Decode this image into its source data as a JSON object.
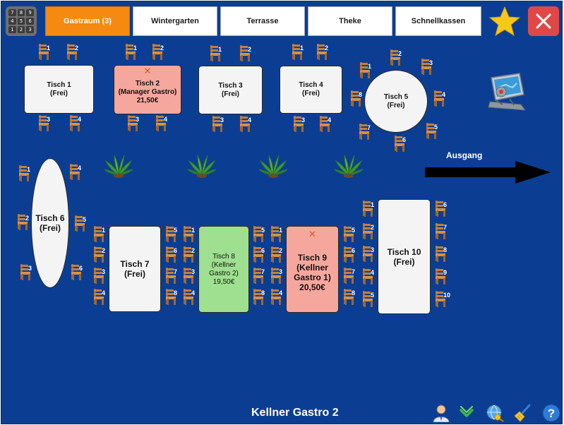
{
  "keypad": {
    "keys": [
      "7",
      "8",
      "9",
      "4",
      "5",
      "6",
      "1",
      "2",
      "3"
    ]
  },
  "tabs": [
    {
      "label": "Gastraum (3)",
      "active": true
    },
    {
      "label": "Wintergarten",
      "active": false
    },
    {
      "label": "Terrasse",
      "active": false
    },
    {
      "label": "Theke",
      "active": false
    },
    {
      "label": "Schnellkassen",
      "active": false
    }
  ],
  "tables": {
    "t1": {
      "name": "Tisch 1",
      "status": "(Frei)"
    },
    "t2": {
      "name": "Tisch 2",
      "status": "(Manager Gastro)",
      "amount": "21,50€"
    },
    "t3": {
      "name": "Tisch 3",
      "status": "(Frei)"
    },
    "t4": {
      "name": "Tisch 4",
      "status": "(Frei)"
    },
    "t5": {
      "name": "Tisch 5",
      "status": "(Frei)"
    },
    "t6": {
      "name": "Tisch 6",
      "status": "(Frei)"
    },
    "t7": {
      "name": "Tisch 7",
      "status": "(Frei)"
    },
    "t8": {
      "name": "Tisch 8",
      "status_line1": "(Kellner",
      "status_line2": "Gastro 2)",
      "amount": "19,50€"
    },
    "t9": {
      "name": "Tisch 9",
      "status_line1": "(Kellner",
      "status_line2": "Gastro 1)",
      "amount": "20,50€"
    },
    "t10": {
      "name": "Tisch 10",
      "status": "(Frei)"
    }
  },
  "exit": {
    "label": "Ausgang"
  },
  "footer": {
    "waiter": "Kellner Gastro 2"
  },
  "colors": {
    "floor": "#0b3e92",
    "active_tab": "#f6890f",
    "occupied_red": "#f6a79d",
    "occupied_green": "#9ee08f",
    "close": "#e04848"
  },
  "icons": [
    "keypad-icon",
    "favorites-star-icon",
    "close-icon",
    "robot-icon",
    "user-icon",
    "chevron-down-icon",
    "globe-key-icon",
    "broom-icon",
    "help-icon",
    "chair-icon",
    "plant-icon"
  ]
}
